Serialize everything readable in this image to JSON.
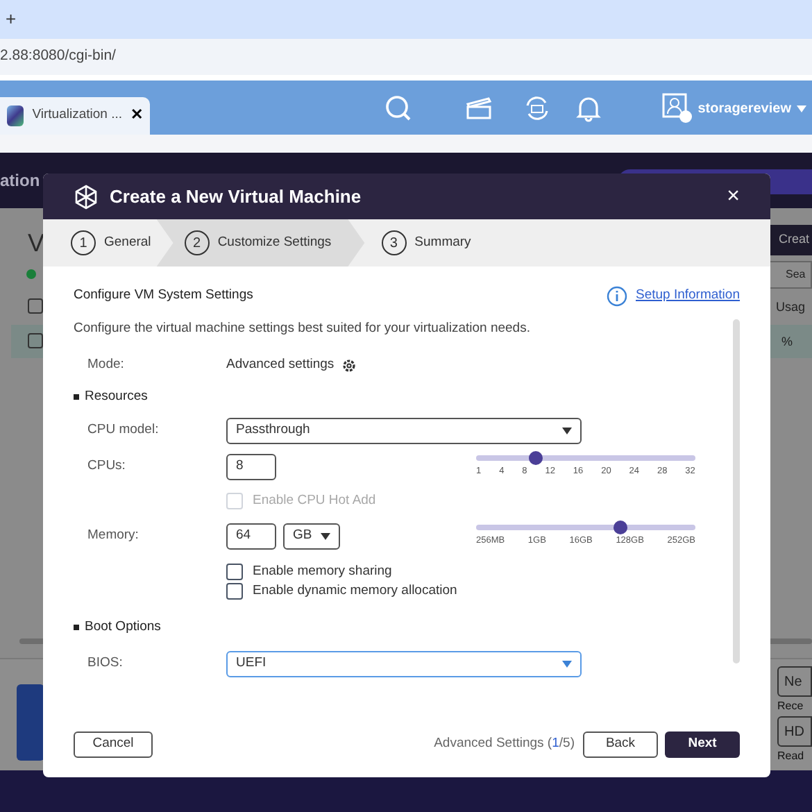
{
  "browser": {
    "new_tab": "+",
    "url": "2.88:8080/cgi-bin/"
  },
  "app": {
    "tab": {
      "label": "Virtualization ...",
      "close": "✕"
    },
    "user": "storagereview",
    "page_title": "ation",
    "section_title": "V",
    "create_button": "Creat",
    "search_placeholder": "Sea",
    "column_header": "Usag",
    "rows": [
      {
        "checked": false,
        "selected": false
      },
      {
        "checked": false,
        "selected": true,
        "cell": "%"
      }
    ],
    "side_items": [
      {
        "kind": "button",
        "label": "Ne"
      },
      {
        "kind": "text",
        "label": "Rece"
      },
      {
        "kind": "button",
        "label": "HD"
      },
      {
        "kind": "text",
        "label": "Read"
      }
    ]
  },
  "dialog": {
    "title": "Create a New Virtual Machine",
    "close": "×",
    "steps": [
      {
        "number": "1",
        "label": "General",
        "selected": false
      },
      {
        "number": "2",
        "label": "Customize Settings",
        "selected": true
      },
      {
        "number": "3",
        "label": "Summary",
        "selected": false
      }
    ],
    "heading": "Configure VM System Settings",
    "setup_link": "Setup Information",
    "description": "Configure the virtual machine settings best suited for your virtualization needs.",
    "mode": {
      "label": "Mode:",
      "value": "Advanced settings"
    },
    "resources": {
      "title": "Resources",
      "cpu_model": {
        "label": "CPU model:",
        "value": "Passthrough"
      },
      "cpus": {
        "label": "CPUs:",
        "value": "8",
        "level": 0.27,
        "ticks": [
          "1",
          "4",
          "8",
          "12",
          "16",
          "20",
          "24",
          "28",
          "32"
        ]
      },
      "cpu_hot_add": {
        "label": "Enable CPU Hot Add",
        "checked": false,
        "disabled": true
      },
      "memory": {
        "label": "Memory:",
        "value": "64",
        "unit": "GB",
        "level": 0.66,
        "ticks": [
          "256MB",
          "1GB",
          "16GB",
          "128GB",
          "252GB"
        ]
      },
      "options": [
        {
          "label": "Enable memory sharing",
          "checked": false,
          "disabled": false
        },
        {
          "label": "Enable dynamic memory allocation",
          "checked": false,
          "disabled": false
        }
      ]
    },
    "boot": {
      "title": "Boot Options",
      "bios": {
        "label": "BIOS:",
        "value": "UEFI"
      }
    },
    "footer": {
      "cancel": "Cancel",
      "progress": {
        "before": "Advanced Settings (",
        "current": "1",
        "after": "/5)"
      },
      "back": "Back",
      "next": "Next"
    }
  }
}
